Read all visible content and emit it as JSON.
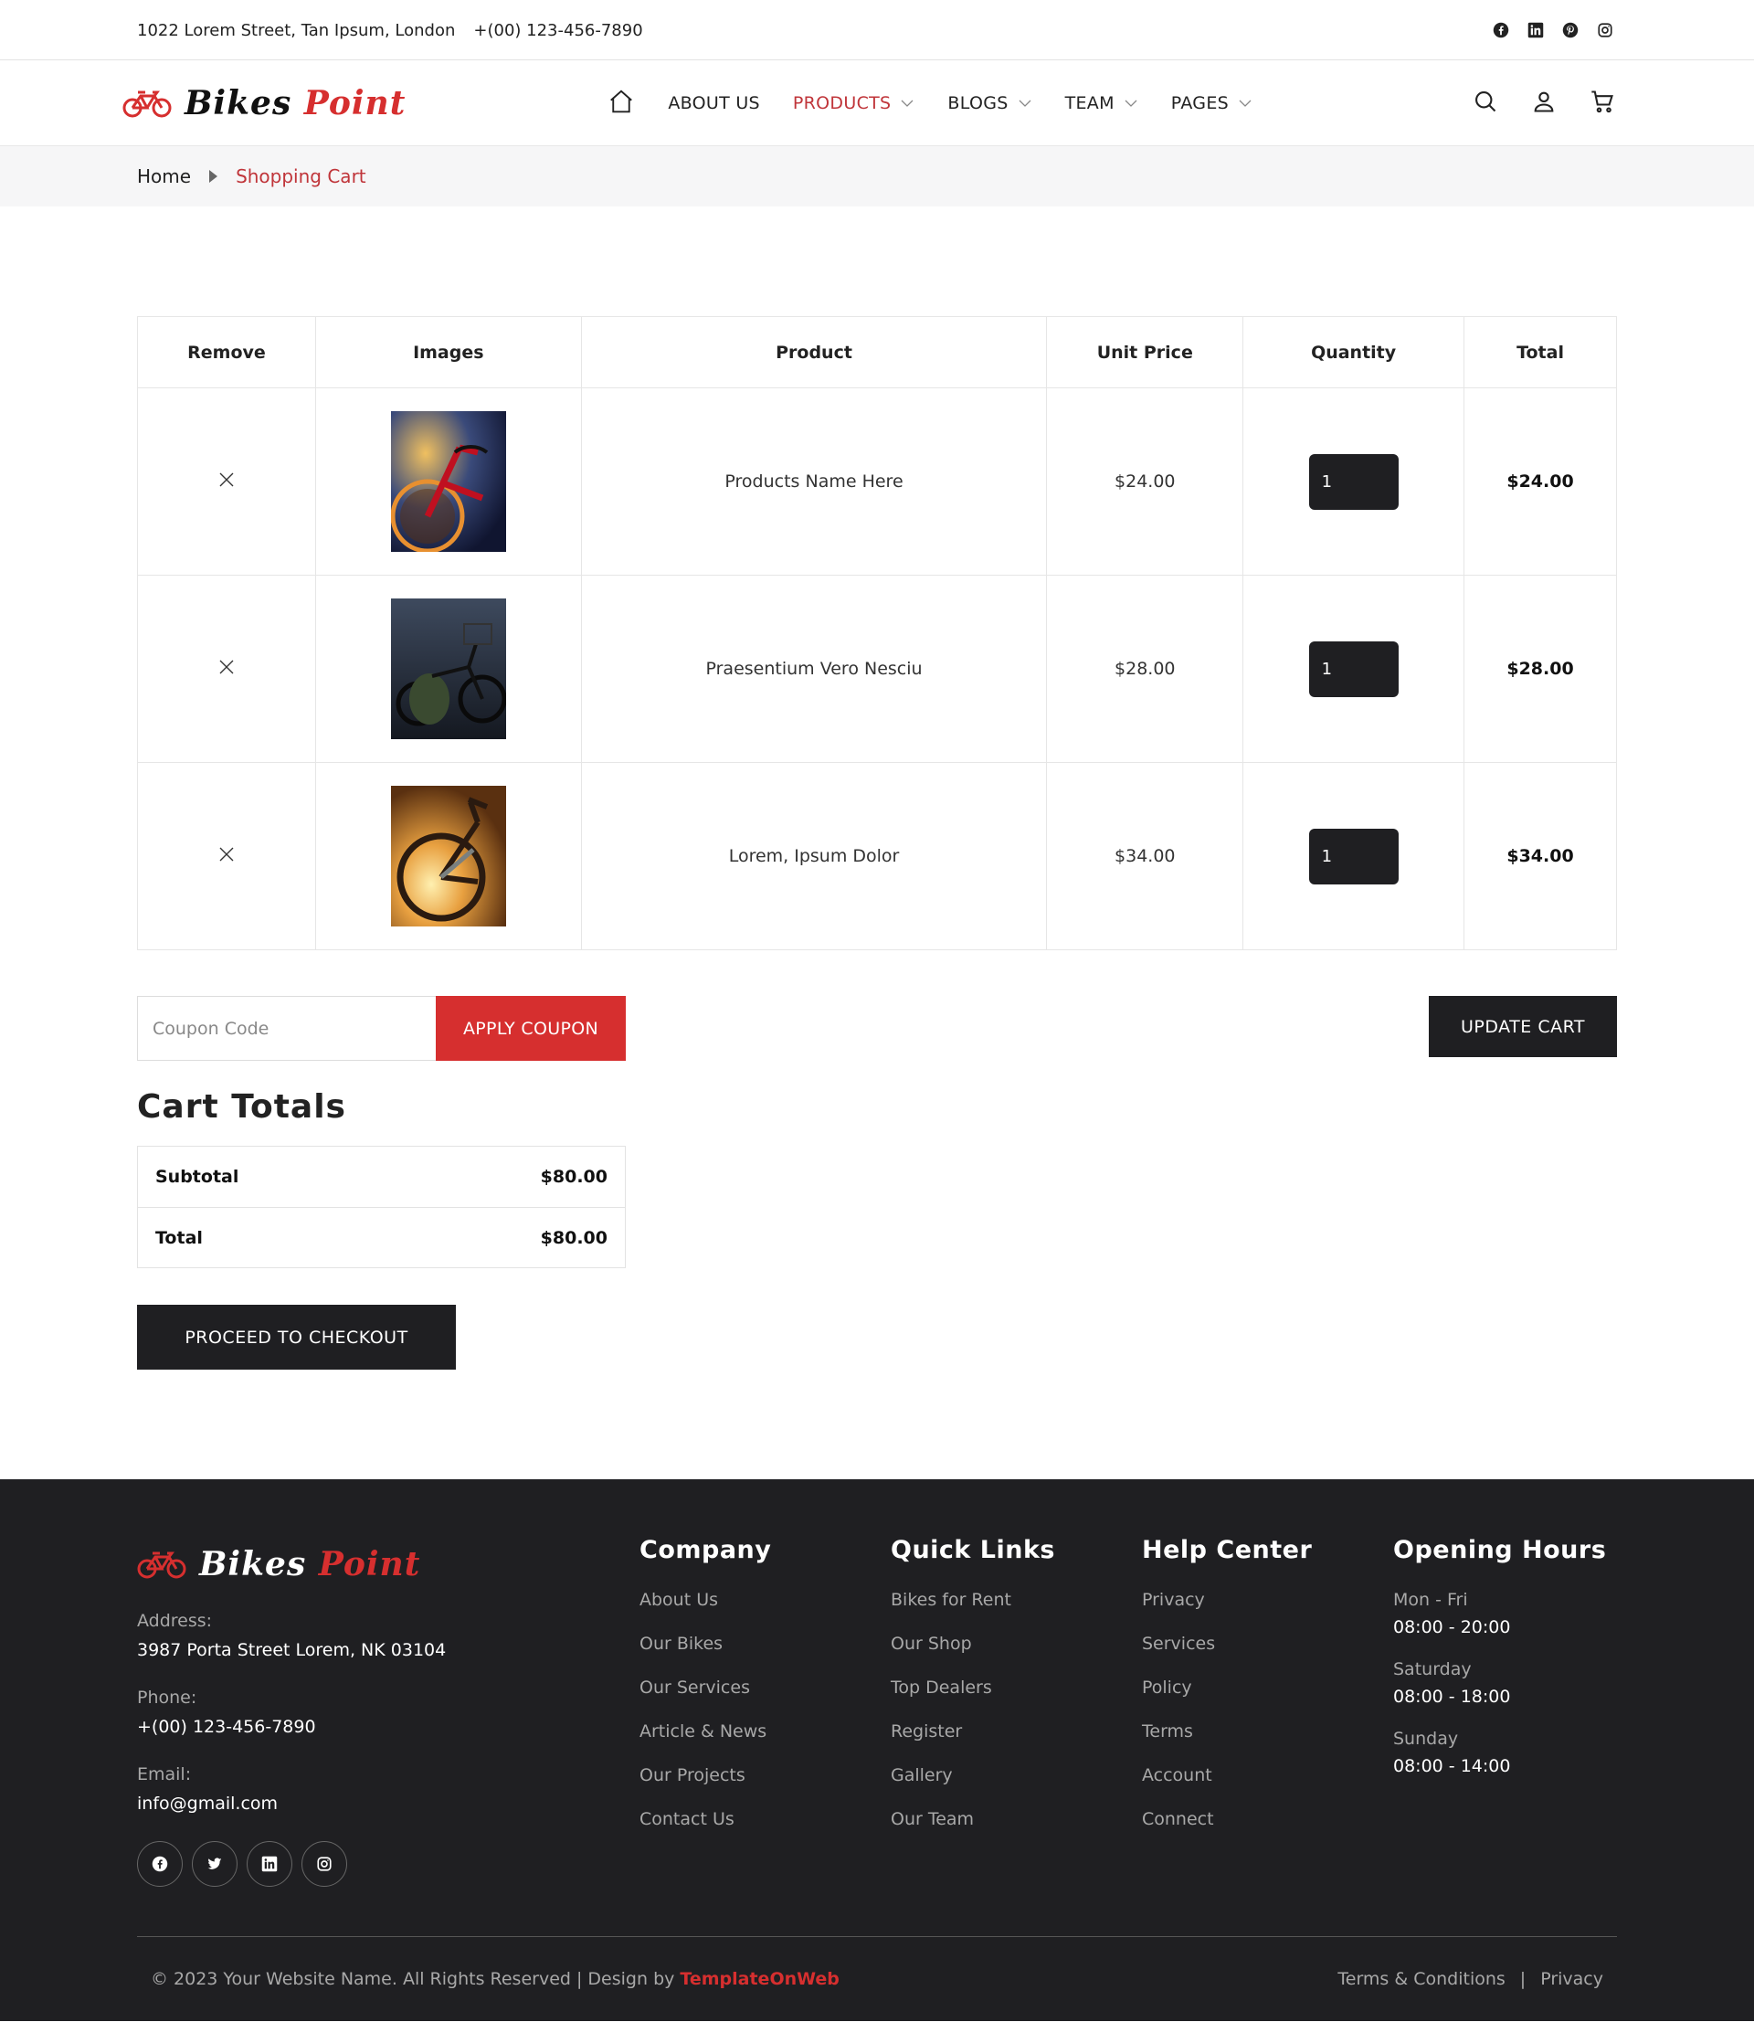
{
  "topbar": {
    "address": "1022 Lorem Street, Tan Ipsum, London",
    "phone": "+(00) 123-456-7890",
    "social_icons": [
      "facebook-icon",
      "linkedin-icon",
      "pinterest-icon",
      "instagram-icon"
    ]
  },
  "brand": {
    "name_part1": "Bikes ",
    "name_part2": "Point",
    "accent": "#d62f2f",
    "dark": "#1f1f22"
  },
  "nav": {
    "items": [
      {
        "label": "ABOUT US",
        "dropdown": false,
        "active": false
      },
      {
        "label": "PRODUCTS",
        "dropdown": true,
        "active": true
      },
      {
        "label": "BLOGS",
        "dropdown": true,
        "active": false
      },
      {
        "label": "TEAM",
        "dropdown": true,
        "active": false
      },
      {
        "label": "PAGES",
        "dropdown": true,
        "active": false
      }
    ]
  },
  "breadcrumb": {
    "home": "Home",
    "current": "Shopping Cart"
  },
  "cart": {
    "headers": [
      "Remove",
      "Images",
      "Product",
      "Unit Price",
      "Quantity",
      "Total"
    ],
    "rows": [
      {
        "product": "Products Name Here",
        "unit_price": "$24.00",
        "qty": "1",
        "total": "$24.00"
      },
      {
        "product": "Praesentium Vero Nesciu",
        "unit_price": "$28.00",
        "qty": "1",
        "total": "$28.00"
      },
      {
        "product": "Lorem, Ipsum Dolor",
        "unit_price": "$34.00",
        "qty": "1",
        "total": "$34.00"
      }
    ]
  },
  "coupon": {
    "placeholder": "Coupon Code",
    "button": "APPLY COUPON"
  },
  "update_button": "UPDATE CART",
  "totals": {
    "title": "Cart Totals",
    "subtotal_label": "Subtotal",
    "subtotal": "$80.00",
    "total_label": "Total",
    "total": "$80.00"
  },
  "checkout_button": "PROCEED TO CHECKOUT",
  "footer": {
    "address_label": "Address:",
    "address": "3987 Porta Street Lorem, NK 03104",
    "phone_label": "Phone:",
    "phone": "+(00) 123-456-7890",
    "email_label": "Email:",
    "email": "info@gmail.com",
    "company": {
      "title": "Company",
      "links": [
        "About Us",
        "Our Bikes",
        "Our Services",
        "Article & News",
        "Our Projects",
        "Contact Us"
      ]
    },
    "quick": {
      "title": "Quick Links",
      "links": [
        "Bikes for Rent",
        "Our Shop",
        "Top Dealers",
        "Register",
        "Gallery",
        "Our Team"
      ]
    },
    "help": {
      "title": "Help Center",
      "links": [
        "Privacy",
        "Services",
        "Policy",
        "Terms",
        "Account",
        "Connect"
      ]
    },
    "hours": {
      "title": "Opening Hours",
      "d1": "Mon - Fri",
      "h1": "08:00 - 20:00",
      "d2": "Saturday",
      "h2": "08:00 - 18:00",
      "d3": "Sunday",
      "h3": "08:00 - 14:00"
    },
    "copyright": "© 2023 Your Website Name. All Rights Reserved | Design by ",
    "design_brand": "TemplateOnWeb",
    "terms": "Terms & Conditions",
    "sep": "|",
    "privacy": "Privacy"
  }
}
